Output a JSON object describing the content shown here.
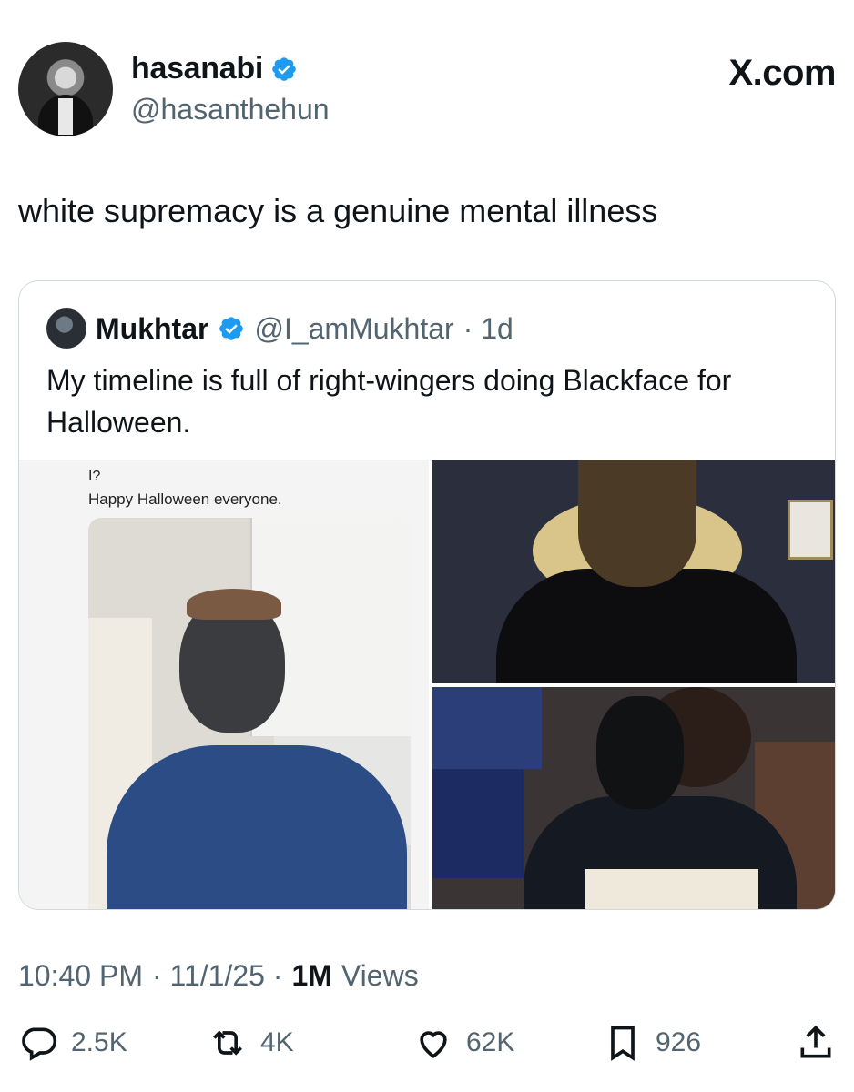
{
  "author": {
    "display_name": "hasanabi",
    "handle": "@hasanthehun"
  },
  "brand": "X.com",
  "tweet": {
    "text": "white supremacy is a genuine mental illness"
  },
  "quote": {
    "display_name": "Mukhtar",
    "handle": "@I_amMukhtar",
    "time": "· 1d",
    "text": "My timeline is full of right-wingers doing Blackface for Halloween.",
    "media": {
      "screenshot_question": "I?",
      "screenshot_text": "Happy Halloween everyone."
    }
  },
  "meta": {
    "time": "10:40 PM",
    "date": "· 11/1/25 ·",
    "views_count": "1M",
    "views_label": "Views"
  },
  "actions": {
    "replies": "2.5K",
    "reposts": "4K",
    "likes": "62K",
    "bookmarks": "926"
  },
  "colors": {
    "verified": "#1d9bf0",
    "secondary_text": "#536471",
    "border": "#cfd9de"
  }
}
